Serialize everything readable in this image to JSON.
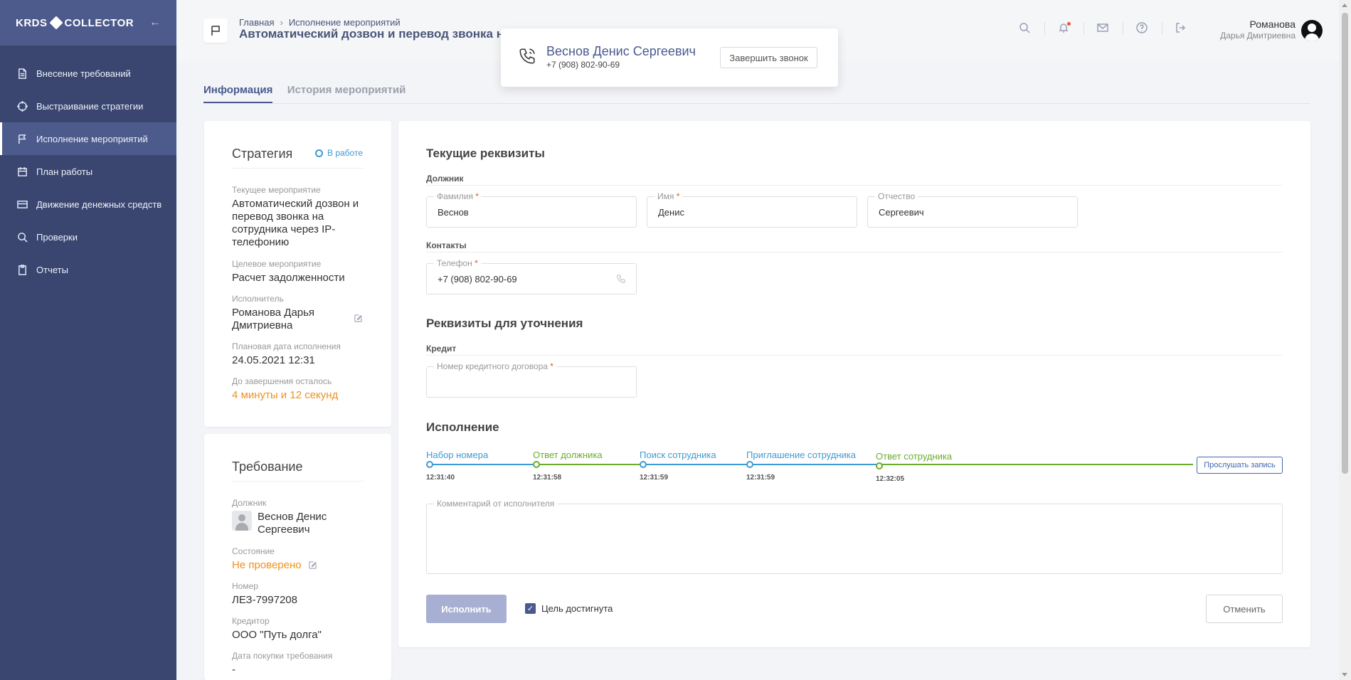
{
  "sidebar": {
    "logo_left": "KRDS",
    "logo_right": "COLLECTOR",
    "items": [
      {
        "label": "Внесение требований",
        "icon": "document-icon"
      },
      {
        "label": "Выстраивание стратегии",
        "icon": "target-icon"
      },
      {
        "label": "Исполнение мероприятий",
        "icon": "flag-icon",
        "active": true
      },
      {
        "label": "План работы",
        "icon": "calendar-icon"
      },
      {
        "label": "Движение денежных средств",
        "icon": "card-icon"
      },
      {
        "label": "Проверки",
        "icon": "search-icon"
      },
      {
        "label": "Отчеты",
        "icon": "clipboard-icon"
      }
    ]
  },
  "header": {
    "breadcrumb": [
      "Главная",
      "Исполнение мероприятий"
    ],
    "title": "Автоматический дозвон и перевод звонка н",
    "user_last": "Романова",
    "user_first": "Дарья Дмитриевна"
  },
  "call": {
    "name": "Веснов Денис Сергеевич",
    "phone": "+7 (908) 802-90-69",
    "end_button": "Завершить звонок"
  },
  "tabs": [
    "Информация",
    "История мероприятий"
  ],
  "strategy": {
    "title": "Стратегия",
    "status": "В работе",
    "current_label": "Текущее мероприятие",
    "current_value": "Автоматический дозвон и перевод звонка на сотрудника через IP-телефонию",
    "target_label": "Целевое мероприятие",
    "target_value": "Расчет задолженности",
    "executor_label": "Исполнитель",
    "executor_value": "Романова Дарья Дмитриевна",
    "planned_label": "Плановая дата исполнения",
    "planned_value": "24.05.2021 12:31",
    "remaining_label": "До завершения осталось",
    "remaining_value": "4 минуты и 12 секунд"
  },
  "claim": {
    "title": "Требование",
    "debtor_label": "Должник",
    "debtor_value": "Веснов Денис Сергеевич",
    "state_label": "Состояние",
    "state_value": "Не проверено",
    "number_label": "Номер",
    "number_value": "ЛЕЗ-7997208",
    "creditor_label": "Кредитор",
    "creditor_value": "ООО \"Путь долга\"",
    "purchase_label": "Дата покупки требования",
    "purchase_value": "-"
  },
  "main": {
    "current_title": "Текущие реквизиты",
    "debtor_sub": "Должник",
    "last_name_label": "Фамилия",
    "last_name": "Веснов",
    "first_name_label": "Имя",
    "first_name": "Денис",
    "middle_name_label": "Отчество",
    "middle_name": "Сергеевич",
    "contacts_sub": "Контакты",
    "phone_label": "Телефон",
    "phone": "+7 (908) 802-90-69",
    "clarify_title": "Реквизиты для уточнения",
    "credit_sub": "Кредит",
    "contract_label": "Номер кредитного договора",
    "contract_value": "",
    "execution_title": "Исполнение",
    "timeline": [
      {
        "label": "Набор номера",
        "time": "12:31:40",
        "color": "#3e9ad2"
      },
      {
        "label": "Ответ должника",
        "time": "12:31:58",
        "color": "#6aad2c"
      },
      {
        "label": "Поиск сотрудника",
        "time": "12:31:59",
        "color": "#3e9ad2"
      },
      {
        "label": "Приглашение сотрудника",
        "time": "12:31:59",
        "color": "#3e9ad2"
      },
      {
        "label": "Ответ сотрудника",
        "time": "12:32:05",
        "color": "#6aad2c"
      }
    ],
    "listen_button": "Прослушать запись",
    "comment_label": "Комментарий от исполнителя",
    "execute_button": "Исполнить",
    "goal_checkbox": "Цель достигнута",
    "goal_checked": true,
    "cancel_button": "Отменить"
  },
  "colors": {
    "sidebar": "#3a4670",
    "accent": "#4a5a8f",
    "blue": "#3e9ad2",
    "green": "#6aad2c",
    "orange": "#f0901e"
  }
}
